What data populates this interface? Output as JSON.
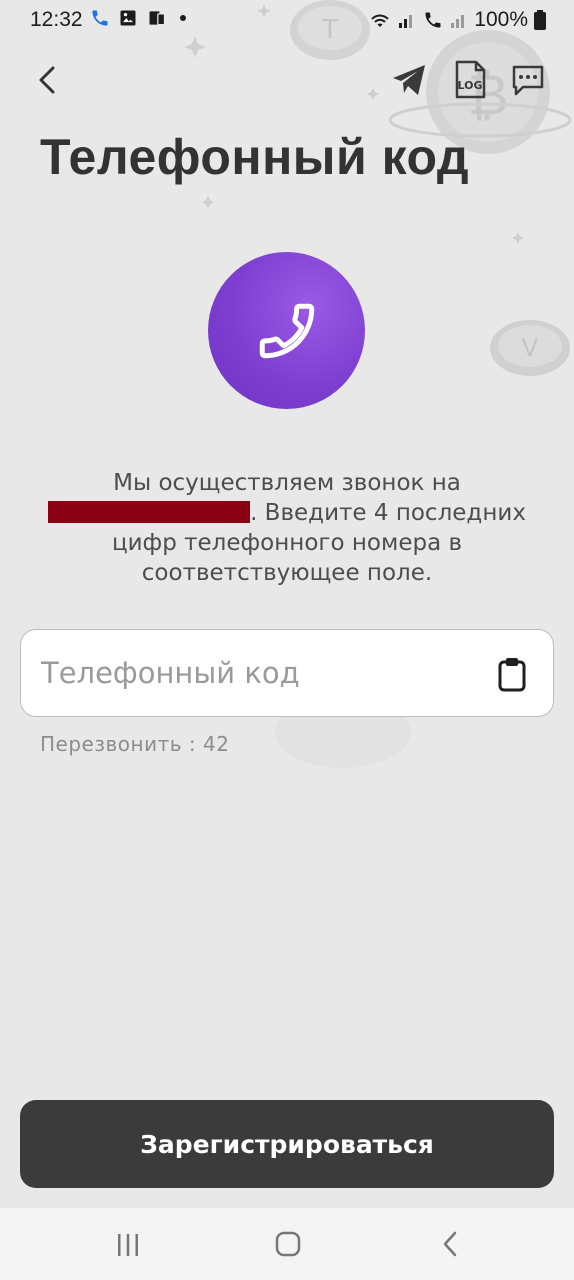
{
  "status_bar": {
    "time": "12:32",
    "battery": "100%"
  },
  "header": {
    "title": "Телефонный код"
  },
  "message": {
    "line_before": "Мы осуществляем звонок на",
    "line_after": ". Введите 4 последних цифр телефонного номера в соответствующее поле."
  },
  "code_field": {
    "placeholder": "Телефонный код",
    "value": ""
  },
  "resend": {
    "label": "Перезвонить : 42"
  },
  "register_button": {
    "label": "Зарегистрироваться"
  },
  "icons": {
    "back": "chevron-left-icon",
    "telegram": "telegram-icon",
    "log": "log-file-icon",
    "chat": "chat-icon",
    "call": "phone-icon",
    "paste": "clipboard-icon"
  },
  "colors": {
    "accent_purple": "#7e3fd1",
    "primary_button": "#3b3b3b",
    "redaction": "#8b0014",
    "background": "#e8e8e8"
  }
}
